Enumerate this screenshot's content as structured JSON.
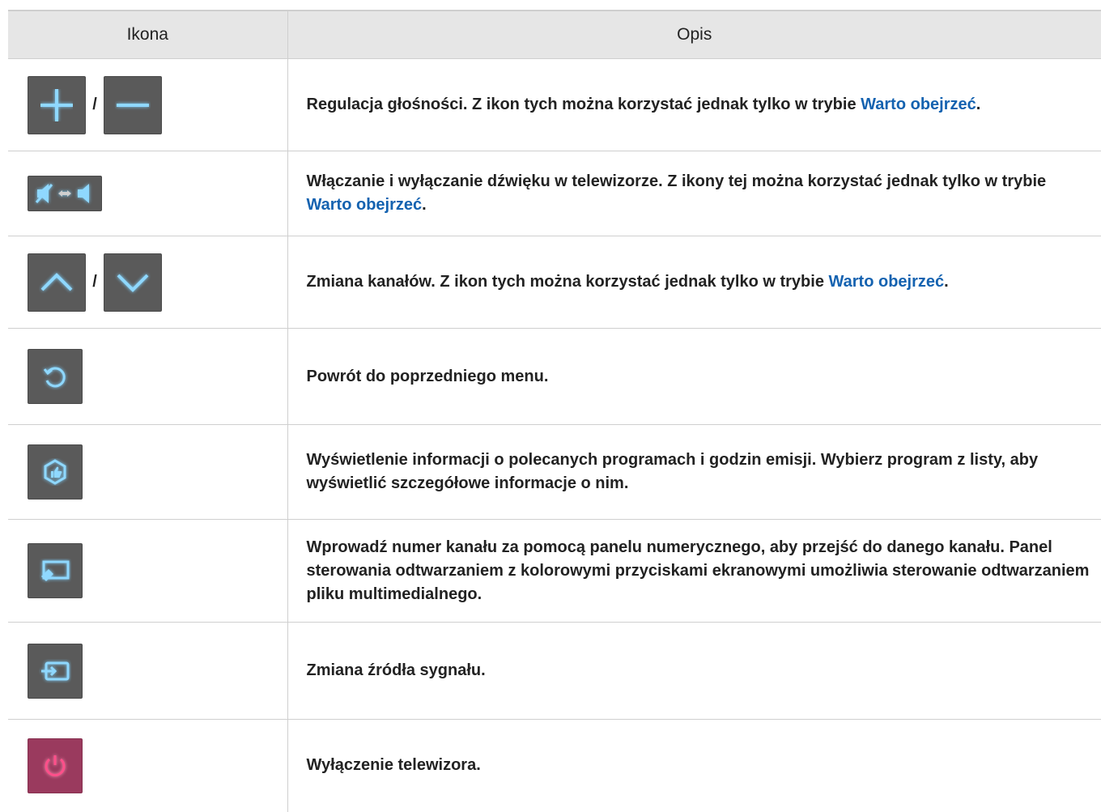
{
  "table": {
    "headers": {
      "icon": "Ikona",
      "description": "Opis"
    },
    "separator": "/",
    "rows": [
      {
        "icons": [
          "plus-icon",
          "minus-icon"
        ],
        "desc_before": "Regulacja głośności. Z ikon tych można korzystać jednak tylko w trybie ",
        "desc_link": "Warto obejrzeć",
        "desc_after": "."
      },
      {
        "icons": [
          "mute-toggle-icon"
        ],
        "desc_before": "Włączanie i wyłączanie dźwięku w telewizorze. Z ikony tej można korzystać jednak tylko w trybie ",
        "desc_link": "Warto obejrzeć",
        "desc_after": "."
      },
      {
        "icons": [
          "chevron-up-icon",
          "chevron-down-icon"
        ],
        "desc_before": "Zmiana kanałów. Z ikon tych można korzystać jednak tylko w trybie ",
        "desc_link": "Warto obejrzeć",
        "desc_after": "."
      },
      {
        "icons": [
          "return-icon"
        ],
        "desc": "Powrót do poprzedniego menu."
      },
      {
        "icons": [
          "recommend-icon"
        ],
        "desc": "Wyświetlenie informacji o polecanych programach i godzin emisji. Wybierz program z listy, aby wyświetlić szczegółowe informacje o nim."
      },
      {
        "icons": [
          "numeric-panel-icon"
        ],
        "desc": "Wprowadź numer kanału za pomocą panelu numerycznego, aby przejść do danego kanału. Panel sterowania odtwarzaniem z kolorowymi przyciskami ekranowymi umożliwia sterowanie odtwarzaniem pliku multimedialnego."
      },
      {
        "icons": [
          "source-icon"
        ],
        "desc": "Zmiana źródła sygnału."
      },
      {
        "icons": [
          "power-icon"
        ],
        "desc": "Wyłączenie telewizora."
      }
    ]
  },
  "colors": {
    "link": "#1462b0",
    "icon_button": "#5a5a5a",
    "icon_glyph": "#8fd8ff",
    "power_button": "#9a3a5e",
    "power_glyph": "#ff4f8a",
    "header_bg": "#e6e6e6"
  }
}
